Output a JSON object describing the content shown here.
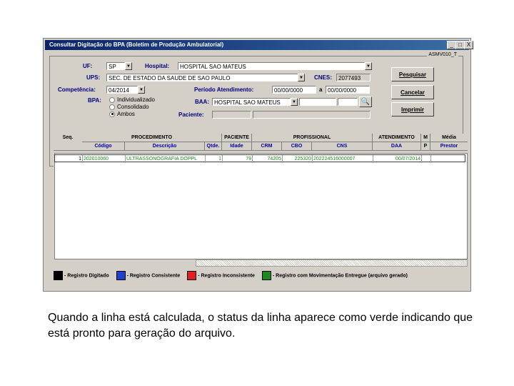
{
  "window": {
    "title": "Consultar Digitação do BPA (Boletim de Produção Ambulatorial)",
    "buttons": [
      "_",
      "□",
      "X"
    ],
    "form_code": "ASMV010_T"
  },
  "form": {
    "uf_label": "UF:",
    "uf_value": "SP",
    "hospital_label": "Hospital:",
    "hospital_value": "HOSPITAL SAO MATEUS",
    "ups_label": "UPS:",
    "ups_value": "SEC. DE ESTADO DA SAUDE DE SAO PAULO",
    "cnes_label": "CNES:",
    "cnes_value": "2077493",
    "competencia_label": "Competência:",
    "competencia_value": "04/2014",
    "periodo_label": "Período Atendimento:",
    "periodo_from": "00/00/0000",
    "periodo_sep": "a",
    "periodo_to": "00/00/0000",
    "bpa_label": "BPA:",
    "radio_options": [
      "Individualizado",
      "Consolidado",
      "Ambos"
    ],
    "radio_selected": 2,
    "baa_label": "BAA:",
    "baa_value": "HOSPITAL SAO MATEUS",
    "paciente_label": "Paciente:",
    "paciente_value": ""
  },
  "actions": {
    "search": "Pesquisar",
    "cancel": "Cancelar",
    "print": "Imprimir"
  },
  "grid": {
    "group_headers": [
      "Seq.",
      "PROCEDIMENTO",
      "PACIENTE",
      "PROFISSIONAL",
      "ATENDIMENTO",
      "M",
      "Média"
    ],
    "sub_headers": [
      "Código",
      "Descrição",
      "Qtde.",
      "Idade",
      "CRM",
      "CBO",
      "CNS",
      "DAA",
      "P",
      "Prestor"
    ],
    "rows": [
      {
        "seq": "1",
        "codigo": "202010060",
        "descricao": "ULTRASSONOGRAFIA DOPPL",
        "qtde": "1",
        "idade": "79",
        "crm": "74205",
        "cbo": "225320",
        "cns": "202224516000007",
        "daa": "00/07/2014",
        "p": "",
        "prest": ""
      }
    ]
  },
  "legend": [
    {
      "color": "#000000",
      "label": "- Registro Digitado"
    },
    {
      "color": "#1f3fcf",
      "label": "- Registro Consistente"
    },
    {
      "color": "#e02020",
      "label": "- Registro Inconsistente"
    },
    {
      "color": "#1e8a1e",
      "label": "- Registro com Movimentação Entregue (arquivo gerado)"
    }
  ],
  "caption": "Quando a linha está calculada, o status da linha aparece como verde indicando que está pronto para geração do arquivo."
}
